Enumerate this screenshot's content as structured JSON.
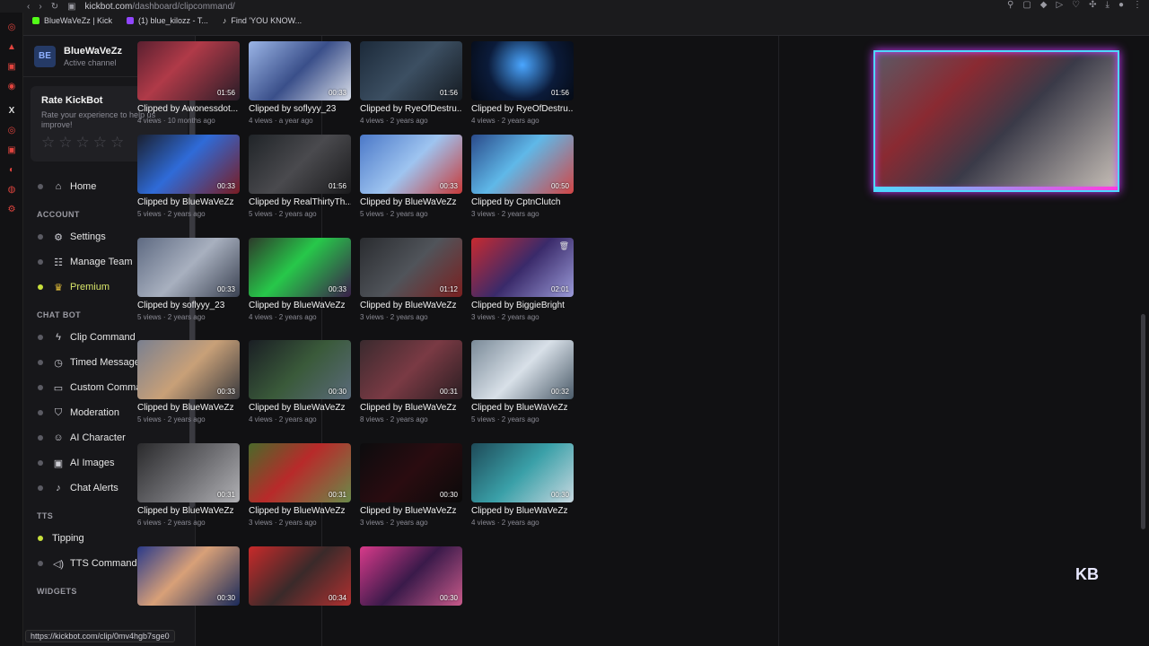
{
  "browser": {
    "url_domain": "kickbot.com",
    "url_path": "/dashboard/clipcommand/",
    "bookmarks": [
      {
        "label": "BlueWaVeZz | Kick",
        "color": "#53fc18"
      },
      {
        "label": "(1) blue_kilozz - T...",
        "color": "#9146ff"
      },
      {
        "label": "Find 'YOU KNOW...",
        "color": "#dddddd"
      }
    ],
    "status_url": "https://kickbot.com/clip/0mv4hgb7sge0"
  },
  "channel": {
    "name": "BlueWaVeZz",
    "subtitle": "Active channel",
    "logo_text": "BE"
  },
  "rate_card": {
    "title": "Rate KickBot",
    "description": "Rate your experience to help us improve!",
    "close": "×",
    "stars": [
      "☆",
      "☆",
      "☆",
      "☆",
      "☆"
    ]
  },
  "nav": {
    "home": "Home",
    "account_section": "ACCOUNT",
    "settings": "Settings",
    "manage_team": "Manage Team",
    "premium": "Premium",
    "chatbot_section": "CHAT BOT",
    "clip_command": "Clip Command",
    "timed_messages": "Timed Messages",
    "custom_commands": "Custom Commands",
    "moderation": "Moderation",
    "ai_character": "AI Character",
    "ai_images": "AI Images",
    "chat_alerts": "Chat Alerts",
    "tts_section": "TTS",
    "tipping": "Tipping",
    "tts_commands": "TTS Commands",
    "widgets_section": "WIDGETS"
  },
  "clips": [
    {
      "title": "Clipped by Awonessdot...",
      "meta": "4 views · 10 months ago",
      "duration": "01:56"
    },
    {
      "title": "Clipped by soflyyy_23",
      "meta": "4 views · a year ago",
      "duration": "00:33"
    },
    {
      "title": "Clipped by RyeOfDestru...",
      "meta": "4 views · 2 years ago",
      "duration": "01:56"
    },
    {
      "title": "Clipped by RyeOfDestru...",
      "meta": "4 views · 2 years ago",
      "duration": "01:56"
    },
    {
      "title": "Clipped by BlueWaVeZz",
      "meta": "5 views · 2 years ago",
      "duration": "00:33"
    },
    {
      "title": "Clipped by RealThirtyTh...",
      "meta": "5 views · 2 years ago",
      "duration": "01:56"
    },
    {
      "title": "Clipped by BlueWaVeZz",
      "meta": "5 views · 2 years ago",
      "duration": "00:33"
    },
    {
      "title": "Clipped by CptnClutch",
      "meta": "3 views · 2 years ago",
      "duration": "00:50"
    },
    {
      "title": "Clipped by soflyyy_23",
      "meta": "5 views · 2 years ago",
      "duration": "00:33"
    },
    {
      "title": "Clipped by BlueWaVeZz",
      "meta": "4 views · 2 years ago",
      "duration": "00:33"
    },
    {
      "title": "Clipped by BlueWaVeZz",
      "meta": "3 views · 2 years ago",
      "duration": "01:12"
    },
    {
      "title": "Clipped by BiggieBright",
      "meta": "3 views · 2 years ago",
      "duration": "02:01"
    },
    {
      "title": "Clipped by BlueWaVeZz",
      "meta": "5 views · 2 years ago",
      "duration": "00:33"
    },
    {
      "title": "Clipped by BlueWaVeZz",
      "meta": "4 views · 2 years ago",
      "duration": "00:30"
    },
    {
      "title": "Clipped by BlueWaVeZz",
      "meta": "8 views · 2 years ago",
      "duration": "00:31"
    },
    {
      "title": "Clipped by BlueWaVeZz",
      "meta": "5 views · 2 years ago",
      "duration": "00:32"
    },
    {
      "title": "Clipped by BlueWaVeZz",
      "meta": "6 views · 2 years ago",
      "duration": "00:31"
    },
    {
      "title": "Clipped by BlueWaVeZz",
      "meta": "3 views · 2 years ago",
      "duration": "00:31"
    },
    {
      "title": "Clipped by BlueWaVeZz",
      "meta": "3 views · 2 years ago",
      "duration": "00:30"
    },
    {
      "title": "Clipped by BlueWaVeZz",
      "meta": "4 views · 2 years ago",
      "duration": "00:30"
    },
    {
      "duration": "00:30"
    },
    {
      "duration": "00:34"
    },
    {
      "duration": "00:30"
    }
  ],
  "corner_logo_text": "KB"
}
